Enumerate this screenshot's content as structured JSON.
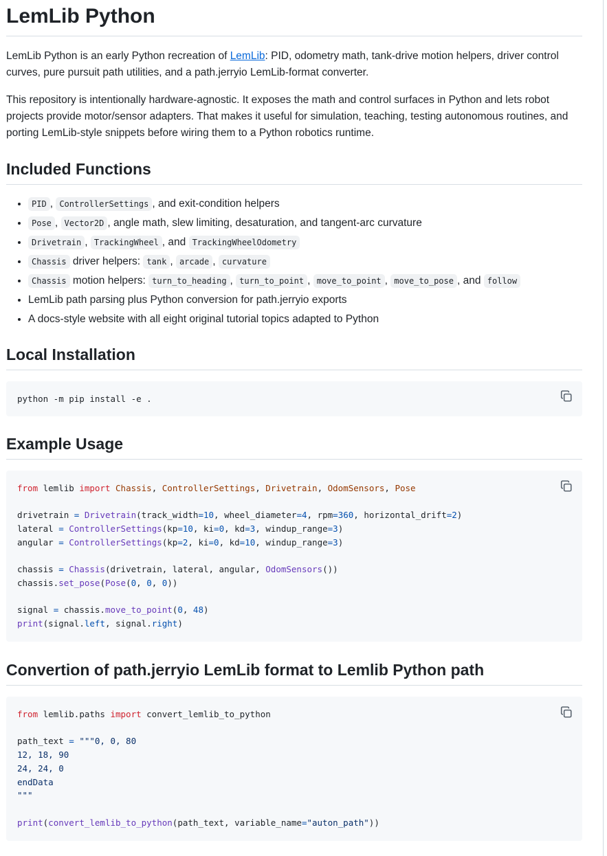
{
  "title": "LemLib Python",
  "intro": {
    "p1_before": "LemLib Python is an early Python recreation of ",
    "p1_link": "LemLib",
    "p1_after": ": PID, odometry math, tank-drive motion helpers, driver control curves, pure pursuit path utilities, and a path.jerryio LemLib-format converter.",
    "p2": "This repository is intentionally hardware-agnostic. It exposes the math and control surfaces in Python and lets robot projects provide motor/sensor adapters. That makes it useful for simulation, teaching, testing autonomous routines, and porting LemLib-style snippets before wiring them to a Python robotics runtime."
  },
  "included": {
    "heading": "Included Functions",
    "items": [
      {
        "codes": [
          "PID",
          "ControllerSettings"
        ],
        "text": ", and exit-condition helpers"
      },
      {
        "codes": [
          "Pose",
          "Vector2D"
        ],
        "text": ", angle math, slew limiting, desaturation, and tangent-arc curvature"
      },
      {
        "codes": [
          "Drivetrain",
          "TrackingWheel"
        ],
        "sep": ", and ",
        "codes2": [
          "TrackingWheelOdometry"
        ]
      },
      {
        "codes": [
          "Chassis"
        ],
        "mid": " driver helpers: ",
        "codes2": [
          "tank",
          "arcade",
          "curvature"
        ]
      },
      {
        "codes": [
          "Chassis"
        ],
        "mid": " motion helpers: ",
        "codes2": [
          "turn_to_heading",
          "turn_to_point",
          "move_to_point",
          "move_to_pose"
        ],
        "and": ", and ",
        "codes3": [
          "follow"
        ]
      },
      {
        "text": "LemLib path parsing plus Python conversion for path.jerryio exports"
      },
      {
        "text": "A docs-style website with all eight original tutorial topics adapted to Python"
      }
    ]
  },
  "install": {
    "heading": "Local Installation",
    "code": "python -m pip install -e ."
  },
  "example": {
    "heading": "Example Usage"
  },
  "convert": {
    "heading": "Convertion of path.jerryio LemLib format to Lemlib Python path"
  },
  "icons": {
    "copy": "copy-icon"
  }
}
